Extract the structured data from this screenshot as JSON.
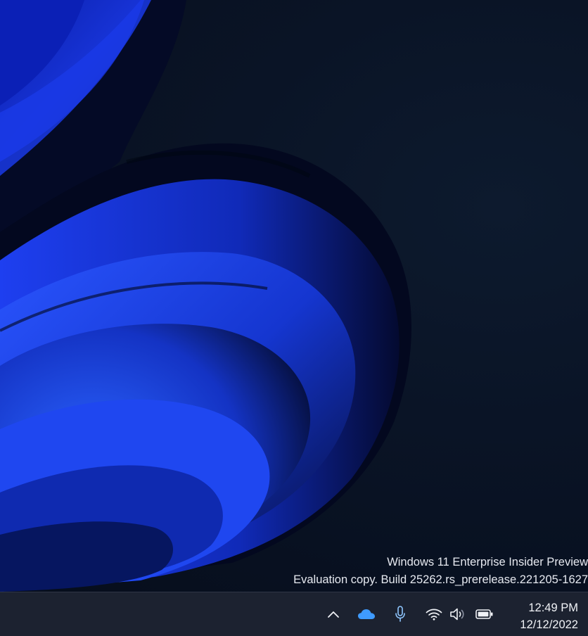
{
  "watermark": {
    "line1": "Windows 11 Enterprise Insider Preview",
    "line2": "Evaluation copy. Build 25262.rs_prerelease.221205-1627"
  },
  "taskbar": {
    "tray_icons": [
      {
        "name": "show-hidden-icons-chevron",
        "icon": "chevron-up-icon"
      },
      {
        "name": "onedrive",
        "icon": "cloud-icon",
        "color": "#3f9bff"
      },
      {
        "name": "microphone-in-use",
        "icon": "microphone-icon",
        "color": "#8fc7ff"
      },
      {
        "name": "network",
        "icon": "wifi-icon"
      },
      {
        "name": "volume",
        "icon": "speaker-icon"
      },
      {
        "name": "battery",
        "icon": "battery-icon"
      }
    ],
    "clock": {
      "time": "12:49 PM",
      "date": "12/12/2022"
    }
  },
  "colors": {
    "taskbar_bg": "#1c2230",
    "desktop_bg": "#070e1c",
    "bloom_blue": "#1f3fe0",
    "onedrive_blue": "#3f9bff"
  }
}
